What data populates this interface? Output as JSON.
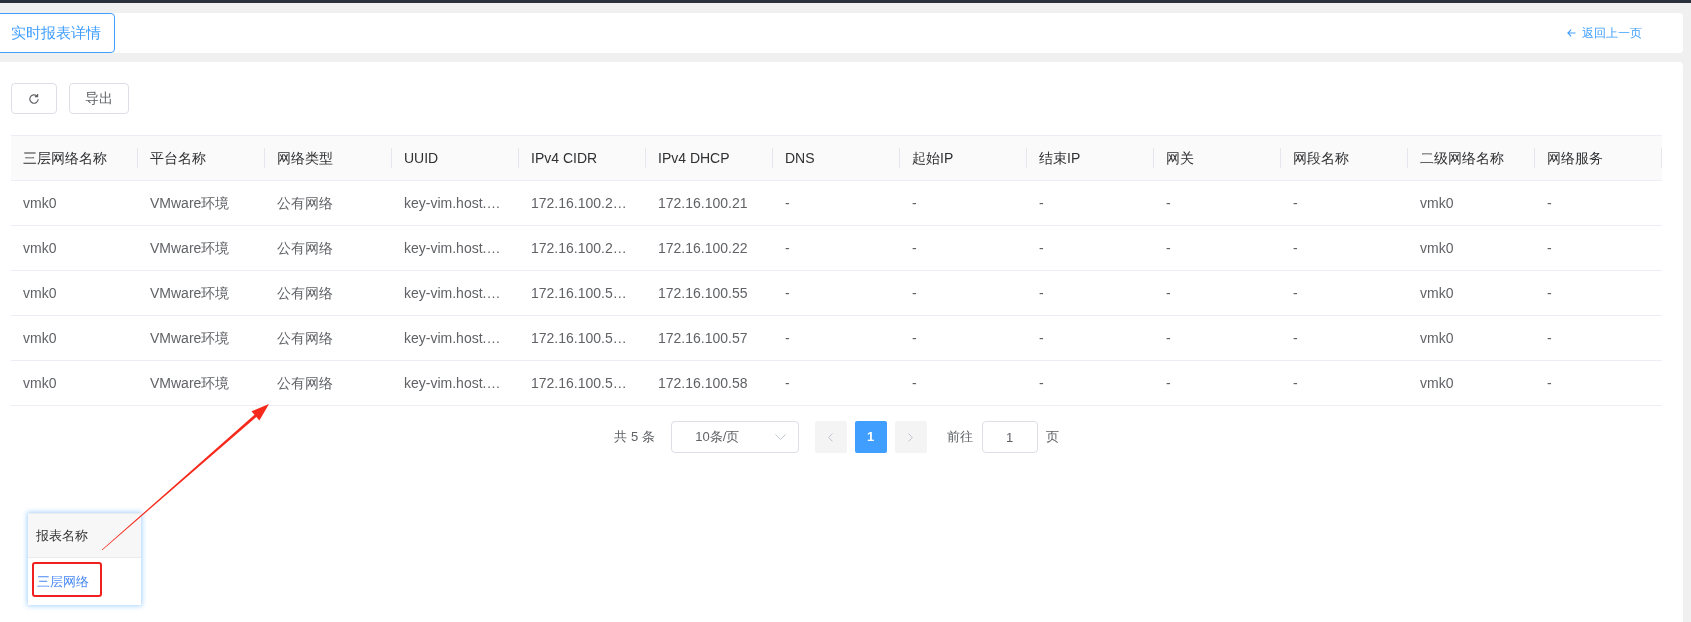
{
  "header": {
    "tab": {
      "label": "实时报表详情",
      "selected": true
    },
    "back_link": "返回上一页"
  },
  "toolbar": {
    "buttons": [
      {
        "kind": "refresh"
      },
      {
        "kind": "text",
        "label": "导出"
      }
    ]
  },
  "table": {
    "columns": [
      "三层网络名称",
      "平台名称",
      "网络类型",
      "UUID",
      "IPv4 CIDR",
      "IPv4 DHCP",
      "DNS",
      "起始IP",
      "结束IP",
      "网关",
      "网段名称",
      "二级网络名称",
      "网络服务"
    ],
    "rows": [
      [
        "vmk0",
        "VMware环境",
        "公有网络",
        "key-vim.host.…",
        "172.16.100.2…",
        "172.16.100.21",
        "-",
        "-",
        "-",
        "-",
        "-",
        "vmk0",
        "-"
      ],
      [
        "vmk0",
        "VMware环境",
        "公有网络",
        "key-vim.host.…",
        "172.16.100.2…",
        "172.16.100.22",
        "-",
        "-",
        "-",
        "-",
        "-",
        "vmk0",
        "-"
      ],
      [
        "vmk0",
        "VMware环境",
        "公有网络",
        "key-vim.host.…",
        "172.16.100.5…",
        "172.16.100.55",
        "-",
        "-",
        "-",
        "-",
        "-",
        "vmk0",
        "-"
      ],
      [
        "vmk0",
        "VMware环境",
        "公有网络",
        "key-vim.host.…",
        "172.16.100.5…",
        "172.16.100.57",
        "-",
        "-",
        "-",
        "-",
        "-",
        "vmk0",
        "-"
      ],
      [
        "vmk0",
        "VMware环境",
        "公有网络",
        "key-vim.host.…",
        "172.16.100.5…",
        "172.16.100.58",
        "-",
        "-",
        "-",
        "-",
        "-",
        "vmk0",
        "-"
      ]
    ]
  },
  "pagination": {
    "total": "共 5 条",
    "page_size": "10条/页",
    "prev": {
      "disabled": true
    },
    "pages": [
      {
        "label": "1",
        "selected": true
      }
    ],
    "next": {
      "disabled": true
    },
    "goto_label": "前往",
    "goto_value": "1",
    "goto_suffix": "页"
  },
  "inset": {
    "column": "报表名称",
    "link": "三层网络"
  }
}
